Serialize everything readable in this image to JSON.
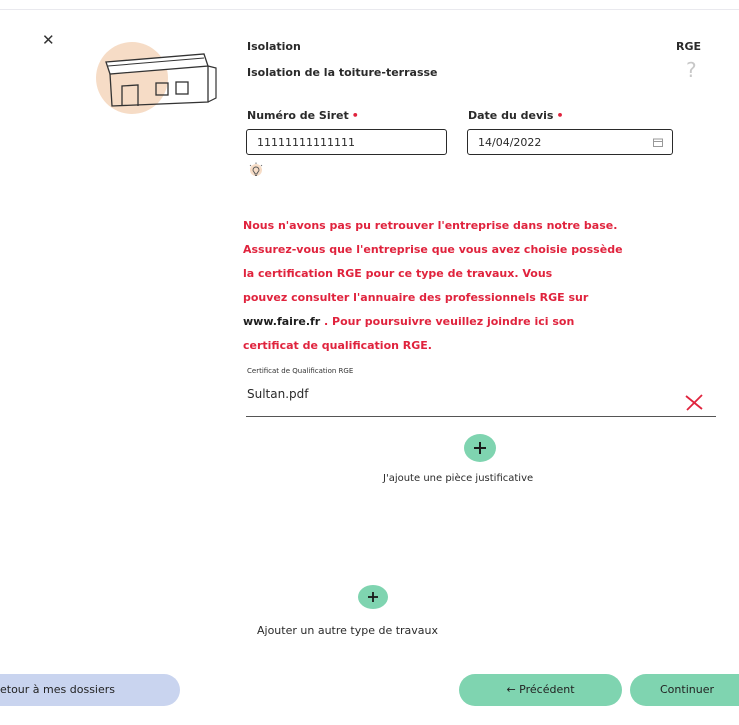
{
  "header": {
    "category": "Isolation",
    "subtitle": "Isolation de la toiture-terrasse",
    "rge_label": "RGE",
    "help_glyph": "?"
  },
  "icons": {
    "close": "close-icon",
    "help": "question-mark-icon",
    "hint": "lightbulb-icon",
    "delete": "delete-x-icon",
    "add": "plus-icon",
    "illustration": "house-illustration"
  },
  "form": {
    "siret": {
      "label": "Numéro de Siret",
      "required_mark": "•",
      "value": "11111111111111"
    },
    "date": {
      "label": "Date du devis",
      "required_mark": "•",
      "value": "14/04/2022",
      "icon": "calendar-icon"
    }
  },
  "warning": {
    "lines": [
      "Nous n'avons pas  pu retrouver l'entreprise  dans notre base.",
      " Assurez-vous que  l'entreprise que vous  avez choisie possède",
      " la certification  RGE pour ce type  de travaux. Vous",
      " pouvez consulter  l'annuaire des  professionnels RGE sur"
    ],
    "site": "www.faire.fr",
    "line5_rest": "  . Pour poursuivre  veuillez joindre ici son",
    "line6": " certificat de qualification RGE."
  },
  "file": {
    "label": "Certificat de Qualification RGE",
    "name": "Sultan.pdf"
  },
  "actions": {
    "add_document": "J'ajoute une pièce justificative",
    "add_work_type": "Ajouter un autre type de travaux"
  },
  "footer": {
    "back": "etour à mes dossiers",
    "previous": "← Précédent",
    "continue": "Continuer"
  },
  "colors": {
    "accent_green": "#7fd4b0",
    "back_blue": "#c9d4ef",
    "warning_red": "#e0233d",
    "illustration_peach": "#f6dcc6"
  }
}
